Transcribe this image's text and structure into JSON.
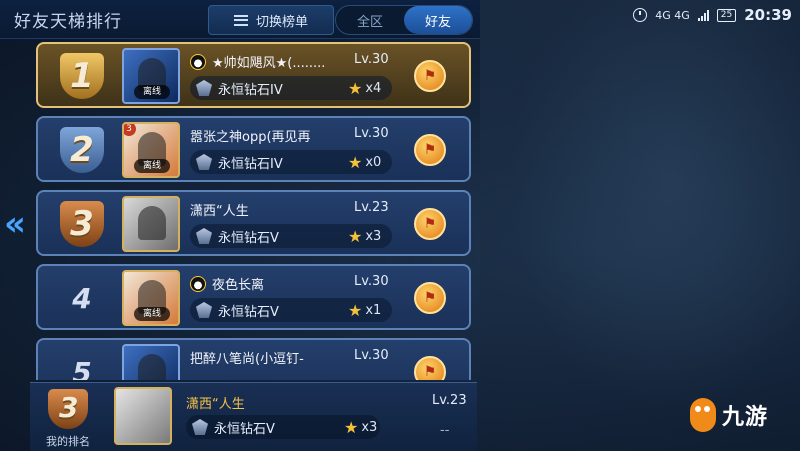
{
  "header": {
    "title": "好友天梯排行",
    "switch_label": "切换榜单",
    "tabs": [
      {
        "label": "全区"
      },
      {
        "label": "好友"
      }
    ]
  },
  "status_bar": {
    "network": "4G 4G",
    "battery": "25",
    "time": "20:39"
  },
  "rows": [
    {
      "rank": "1",
      "name": "★帅如飓风★(........",
      "level": "Lv.30",
      "tier": "永恒钻石IV",
      "stars": "x4",
      "status": "离线"
    },
    {
      "rank": "2",
      "name": "嚣张之神opp(再见再",
      "level": "Lv.30",
      "tier": "永恒钻石IV",
      "stars": "x0",
      "status": "离线",
      "badge": "3"
    },
    {
      "rank": "3",
      "name": "潇西“人生",
      "level": "Lv.23",
      "tier": "永恒钻石V",
      "stars": "x3",
      "status": ""
    },
    {
      "rank": "4",
      "name": "夜色长离",
      "level": "Lv.30",
      "tier": "永恒钻石V",
      "stars": "x1",
      "status": "离线"
    },
    {
      "rank": "5",
      "name": "把醉八笔尚(小逗钉-",
      "level": "Lv.30",
      "tier": "",
      "stars": "",
      "status": ""
    }
  ],
  "my_rank": {
    "rank": "3",
    "label": "我的排名",
    "name": "潇西“人生",
    "level": "Lv.23",
    "tier": "永恒钻石V",
    "stars": "x3",
    "extra": "--"
  },
  "logo": {
    "text": "九游"
  },
  "colors": {
    "accent": "#2f72c8",
    "gold": "#f4c34a",
    "highlight_border": "#e3c27a"
  }
}
